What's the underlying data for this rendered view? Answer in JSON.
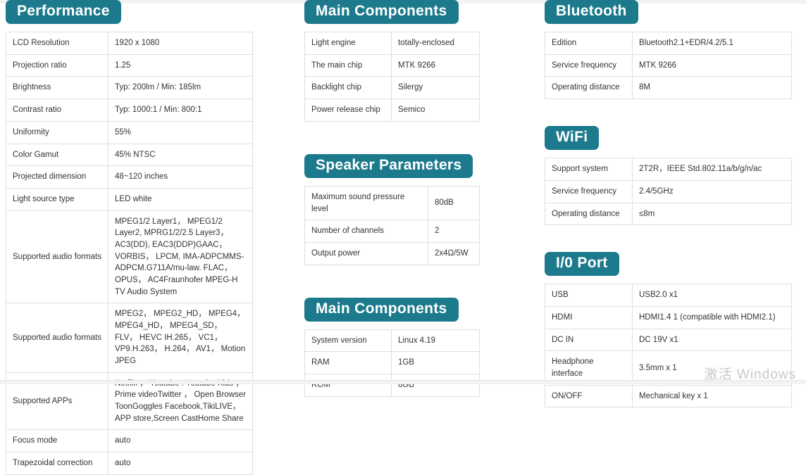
{
  "watermark": "激活 Windows",
  "theme": {
    "accent": "#1c7a8c",
    "border": "#dedede",
    "text": "#333333"
  },
  "sections": {
    "performance": {
      "title": "Performance",
      "rows": [
        {
          "key": "LCD Resolution",
          "value": "1920 x 1080"
        },
        {
          "key": "Projection ratio",
          "value": "1.25"
        },
        {
          "key": "Brightness",
          "value": "Typ: 200lm / Min: 185lm"
        },
        {
          "key": "Contrast ratio",
          "value": "Typ: 1000:1 / Min: 800:1"
        },
        {
          "key": "Uniformity",
          "value": "55%"
        },
        {
          "key": "Color Gamut",
          "value": "45% NTSC"
        },
        {
          "key": "Projected dimension",
          "value": "48~120 inches"
        },
        {
          "key": "Light source type",
          "value": "LED white"
        },
        {
          "key": "Supported audio formats",
          "value": "MPEG1/2 Layer1， MPEG1/2 Layer2, MPRG1/2/2.5 Layer3， AC3(DD), EAC3(DDP)GAAC， VORBIS， LPCM, IMA-ADPCMMS-ADPCM.G711A/mu-law. FLAC， OPUS， AC4Fraunhofer MPEG-H TV Audio System"
        },
        {
          "key": "Supported audio formats",
          "value": "MPEG2， MPEG2_HD， MPEG4， MPEG4_HD， MPEG4_SD， FLV， HEVC IH.265， VC1， VP9.H.263， H.264， AV1， Motion JPEG"
        },
        {
          "key": "Supported APPs",
          "value": "Netflix ， Youtube . Youtube Kids ， Prime videoTwitter ， Open Browser ToonGoggles Facebook,TikiLIVE， APP store,Screen CastHome Share"
        },
        {
          "key": "Focus mode",
          "value": "auto"
        },
        {
          "key": "Trapezoidal correction",
          "value": "auto"
        }
      ]
    },
    "main_components": {
      "title": "Main Components",
      "rows": [
        {
          "key": "Light engine",
          "value": "totally-enclosed"
        },
        {
          "key": "The main chip",
          "value": "MTK 9266"
        },
        {
          "key": "Backlight chip",
          "value": "Silergy"
        },
        {
          "key": "Power release chip",
          "value": "Semico"
        }
      ]
    },
    "speaker_parameters": {
      "title": "Speaker Parameters",
      "rows": [
        {
          "key": "Maximum sound pressure level",
          "value": "80dB"
        },
        {
          "key": "Number of channels",
          "value": "2"
        },
        {
          "key": "Output power",
          "value": "2x4Ω/5W"
        }
      ]
    },
    "system": {
      "title": "Main Components",
      "rows": [
        {
          "key": "System version",
          "value": "Linux 4.19"
        },
        {
          "key": "RAM",
          "value": "1GB"
        },
        {
          "key": "ROM",
          "value": "8GB"
        }
      ]
    },
    "bluetooth": {
      "title": "Bluetooth",
      "rows": [
        {
          "key": "Edition",
          "value": "Bluetooth2.1+EDR/4.2/5.1"
        },
        {
          "key": "Service frequency",
          "value": "MTK 9266"
        },
        {
          "key": "Operating distance",
          "value": "8M"
        }
      ]
    },
    "wifi": {
      "title": "WiFi",
      "rows": [
        {
          "key": "Support system",
          "value": "2T2R，IEEE Std.802.11a/b/g/n/ac"
        },
        {
          "key": "Service frequency",
          "value": "2.4/5GHz"
        },
        {
          "key": "Operating distance",
          "value": "≤8m"
        }
      ]
    },
    "io_port": {
      "title": "I/0 Port",
      "rows": [
        {
          "key": "USB",
          "value": "USB2.0 x1"
        },
        {
          "key": "HDMI",
          "value": "HDMI1.4 1 (compatible with HDMI2.1)"
        },
        {
          "key": "DC IN",
          "value": "DC 19V x1"
        },
        {
          "key": "Headphone interface",
          "value": "3.5mm x 1"
        },
        {
          "key": "ON/OFF",
          "value": "Mechanical key x 1"
        }
      ]
    }
  }
}
